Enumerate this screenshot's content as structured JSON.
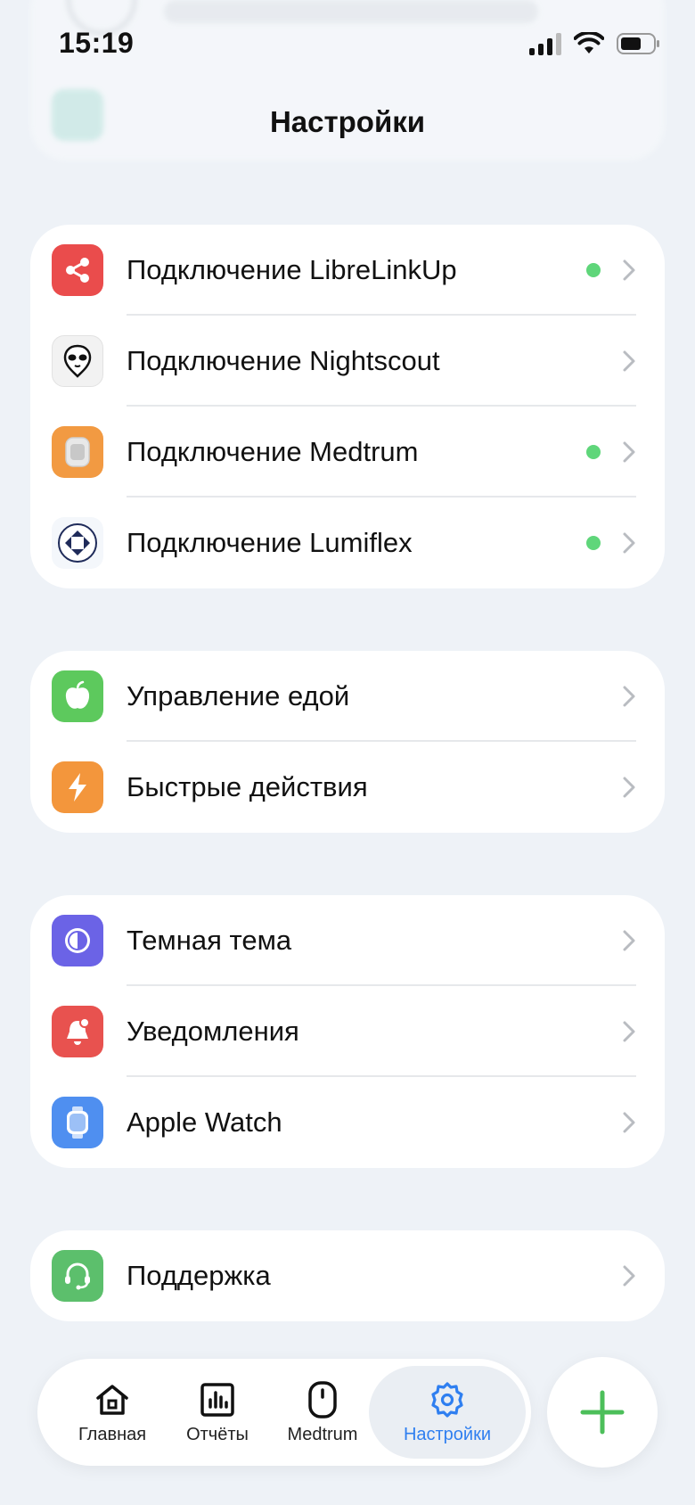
{
  "status_bar": {
    "time": "15:19"
  },
  "page": {
    "title": "Настройки"
  },
  "groups": [
    {
      "items": [
        {
          "label": "Подключение LibreLinkUp",
          "icon": "share-icon",
          "icon_color": "#ea4c4c",
          "connected": true
        },
        {
          "label": "Подключение Nightscout",
          "icon": "alien-icon",
          "icon_color": "#f2f2f2",
          "connected": false
        },
        {
          "label": "Подключение Medtrum",
          "icon": "medtrum-device-icon",
          "icon_color": "#f29a42",
          "connected": true
        },
        {
          "label": "Подключение Lumiflex",
          "icon": "lumiflex-icon",
          "icon_color": "#f4f7fb",
          "connected": true
        }
      ]
    },
    {
      "items": [
        {
          "label": "Управление едой",
          "icon": "apple-icon",
          "icon_color": "#5dc95d"
        },
        {
          "label": "Быстрые действия",
          "icon": "lightning-icon",
          "icon_color": "#f3963c"
        }
      ]
    },
    {
      "items": [
        {
          "label": "Темная тема",
          "icon": "dark-theme-icon",
          "icon_color": "#6b63e6"
        },
        {
          "label": "Уведомления",
          "icon": "bell-icon",
          "icon_color": "#e8524f"
        },
        {
          "label": "Apple Watch",
          "icon": "watch-icon",
          "icon_color": "#4f8ff0"
        }
      ]
    },
    {
      "items": [
        {
          "label": "Поддержка",
          "icon": "headset-icon",
          "icon_color": "#5cbf6c"
        }
      ]
    }
  ],
  "tab_bar": {
    "tabs": [
      {
        "label": "Главная",
        "icon": "home-icon"
      },
      {
        "label": "Отчёты",
        "icon": "chart-icon"
      },
      {
        "label": "Medtrum",
        "icon": "medtrum-icon"
      },
      {
        "label": "Настройки",
        "icon": "settings-gear-icon",
        "active": true
      }
    ]
  },
  "colors": {
    "accent": "#2f7ff0",
    "status_dot": "#5fd67a",
    "fab_plus": "#4cbf5a"
  }
}
